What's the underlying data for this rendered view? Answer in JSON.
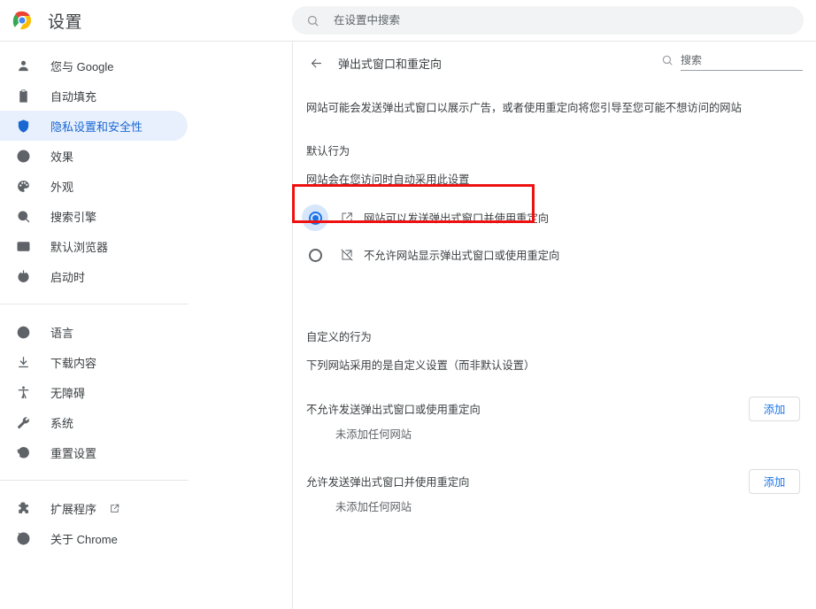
{
  "topbar": {
    "brand_title": "设置",
    "logo_icon": "chrome-logo-icon",
    "search_icon": "search-icon",
    "search_placeholder": "在设置中搜索",
    "search_value": ""
  },
  "sidebar": {
    "groups": [
      {
        "items": [
          {
            "icon": "person-icon",
            "label": "您与 Google",
            "selected": false
          },
          {
            "icon": "clipboard-icon",
            "label": "自动填充",
            "selected": false
          },
          {
            "icon": "shield-icon",
            "label": "隐私设置和安全性",
            "selected": true
          },
          {
            "icon": "speedometer-icon",
            "label": "效果",
            "selected": false
          },
          {
            "icon": "palette-icon",
            "label": "外观",
            "selected": false
          },
          {
            "icon": "search-icon",
            "label": "搜索引擎",
            "selected": false
          },
          {
            "icon": "browser-window-icon",
            "label": "默认浏览器",
            "selected": false
          },
          {
            "icon": "power-icon",
            "label": "启动时",
            "selected": false
          }
        ]
      },
      {
        "items": [
          {
            "icon": "globe-icon",
            "label": "语言",
            "selected": false
          },
          {
            "icon": "download-icon",
            "label": "下载内容",
            "selected": false
          },
          {
            "icon": "accessibility-icon",
            "label": "无障碍",
            "selected": false
          },
          {
            "icon": "wrench-icon",
            "label": "系统",
            "selected": false
          },
          {
            "icon": "history-restore-icon",
            "label": "重置设置",
            "selected": false
          }
        ]
      },
      {
        "items": [
          {
            "icon": "puzzle-icon",
            "label": "扩展程序",
            "selected": false,
            "external": true,
            "external_icon": "external-link-icon"
          },
          {
            "icon": "chrome-outline-icon",
            "label": "关于 Chrome",
            "selected": false
          }
        ]
      }
    ]
  },
  "content": {
    "back_icon": "back-arrow-icon",
    "page_title": "弹出式窗口和重定向",
    "inline_search_icon": "search-icon",
    "inline_search_placeholder": "搜索",
    "inline_search_value": "",
    "description": "网站可能会发送弹出式窗口以展示广告，或者使用重定向将您引导至您可能不想访问的网站",
    "default_behavior": {
      "heading": "默认行为",
      "subheading": "网站会在您访问时自动采用此设置",
      "options": [
        {
          "icon": "popup-allow-icon",
          "label": "网站可以发送弹出式窗口并使用重定向",
          "checked": true,
          "highlighted": true
        },
        {
          "icon": "popup-block-icon",
          "label": "不允许网站显示弹出式窗口或使用重定向",
          "checked": false,
          "highlighted": false
        }
      ]
    },
    "custom_behavior": {
      "heading": "自定义的行为",
      "subheading": "下列网站采用的是自定义设置（而非默认设置）",
      "sections": [
        {
          "label": "不允许发送弹出式窗口或使用重定向",
          "add_label": "添加",
          "empty_note": "未添加任何网站"
        },
        {
          "label": "允许发送弹出式窗口并使用重定向",
          "add_label": "添加",
          "empty_note": "未添加任何网站"
        }
      ]
    }
  },
  "colors": {
    "accent_blue": "#1a73e8",
    "selected_pill": "#e8f0fe",
    "selected_text": "#1967d2",
    "annotation_red": "#ee1111",
    "text_primary": "#3c4043",
    "text_secondary": "#5f6368",
    "divider": "#e4e6e8",
    "search_bg": "#f1f3f4"
  }
}
